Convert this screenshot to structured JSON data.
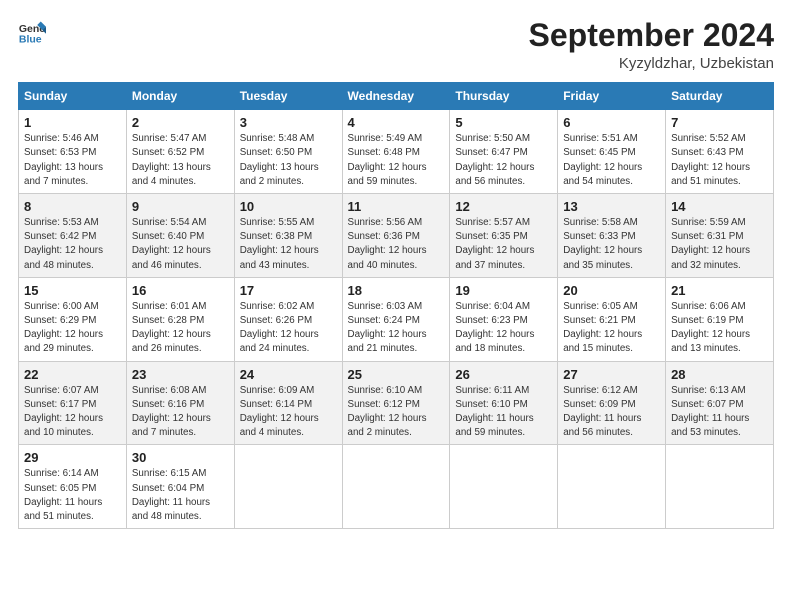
{
  "header": {
    "logo_general": "General",
    "logo_blue": "Blue",
    "title": "September 2024",
    "location": "Kyzyldzhar, Uzbekistan"
  },
  "weekdays": [
    "Sunday",
    "Monday",
    "Tuesday",
    "Wednesday",
    "Thursday",
    "Friday",
    "Saturday"
  ],
  "weeks": [
    [
      {
        "day": "1",
        "detail": "Sunrise: 5:46 AM\nSunset: 6:53 PM\nDaylight: 13 hours\nand 7 minutes."
      },
      {
        "day": "2",
        "detail": "Sunrise: 5:47 AM\nSunset: 6:52 PM\nDaylight: 13 hours\nand 4 minutes."
      },
      {
        "day": "3",
        "detail": "Sunrise: 5:48 AM\nSunset: 6:50 PM\nDaylight: 13 hours\nand 2 minutes."
      },
      {
        "day": "4",
        "detail": "Sunrise: 5:49 AM\nSunset: 6:48 PM\nDaylight: 12 hours\nand 59 minutes."
      },
      {
        "day": "5",
        "detail": "Sunrise: 5:50 AM\nSunset: 6:47 PM\nDaylight: 12 hours\nand 56 minutes."
      },
      {
        "day": "6",
        "detail": "Sunrise: 5:51 AM\nSunset: 6:45 PM\nDaylight: 12 hours\nand 54 minutes."
      },
      {
        "day": "7",
        "detail": "Sunrise: 5:52 AM\nSunset: 6:43 PM\nDaylight: 12 hours\nand 51 minutes."
      }
    ],
    [
      {
        "day": "8",
        "detail": "Sunrise: 5:53 AM\nSunset: 6:42 PM\nDaylight: 12 hours\nand 48 minutes."
      },
      {
        "day": "9",
        "detail": "Sunrise: 5:54 AM\nSunset: 6:40 PM\nDaylight: 12 hours\nand 46 minutes."
      },
      {
        "day": "10",
        "detail": "Sunrise: 5:55 AM\nSunset: 6:38 PM\nDaylight: 12 hours\nand 43 minutes."
      },
      {
        "day": "11",
        "detail": "Sunrise: 5:56 AM\nSunset: 6:36 PM\nDaylight: 12 hours\nand 40 minutes."
      },
      {
        "day": "12",
        "detail": "Sunrise: 5:57 AM\nSunset: 6:35 PM\nDaylight: 12 hours\nand 37 minutes."
      },
      {
        "day": "13",
        "detail": "Sunrise: 5:58 AM\nSunset: 6:33 PM\nDaylight: 12 hours\nand 35 minutes."
      },
      {
        "day": "14",
        "detail": "Sunrise: 5:59 AM\nSunset: 6:31 PM\nDaylight: 12 hours\nand 32 minutes."
      }
    ],
    [
      {
        "day": "15",
        "detail": "Sunrise: 6:00 AM\nSunset: 6:29 PM\nDaylight: 12 hours\nand 29 minutes."
      },
      {
        "day": "16",
        "detail": "Sunrise: 6:01 AM\nSunset: 6:28 PM\nDaylight: 12 hours\nand 26 minutes."
      },
      {
        "day": "17",
        "detail": "Sunrise: 6:02 AM\nSunset: 6:26 PM\nDaylight: 12 hours\nand 24 minutes."
      },
      {
        "day": "18",
        "detail": "Sunrise: 6:03 AM\nSunset: 6:24 PM\nDaylight: 12 hours\nand 21 minutes."
      },
      {
        "day": "19",
        "detail": "Sunrise: 6:04 AM\nSunset: 6:23 PM\nDaylight: 12 hours\nand 18 minutes."
      },
      {
        "day": "20",
        "detail": "Sunrise: 6:05 AM\nSunset: 6:21 PM\nDaylight: 12 hours\nand 15 minutes."
      },
      {
        "day": "21",
        "detail": "Sunrise: 6:06 AM\nSunset: 6:19 PM\nDaylight: 12 hours\nand 13 minutes."
      }
    ],
    [
      {
        "day": "22",
        "detail": "Sunrise: 6:07 AM\nSunset: 6:17 PM\nDaylight: 12 hours\nand 10 minutes."
      },
      {
        "day": "23",
        "detail": "Sunrise: 6:08 AM\nSunset: 6:16 PM\nDaylight: 12 hours\nand 7 minutes."
      },
      {
        "day": "24",
        "detail": "Sunrise: 6:09 AM\nSunset: 6:14 PM\nDaylight: 12 hours\nand 4 minutes."
      },
      {
        "day": "25",
        "detail": "Sunrise: 6:10 AM\nSunset: 6:12 PM\nDaylight: 12 hours\nand 2 minutes."
      },
      {
        "day": "26",
        "detail": "Sunrise: 6:11 AM\nSunset: 6:10 PM\nDaylight: 11 hours\nand 59 minutes."
      },
      {
        "day": "27",
        "detail": "Sunrise: 6:12 AM\nSunset: 6:09 PM\nDaylight: 11 hours\nand 56 minutes."
      },
      {
        "day": "28",
        "detail": "Sunrise: 6:13 AM\nSunset: 6:07 PM\nDaylight: 11 hours\nand 53 minutes."
      }
    ],
    [
      {
        "day": "29",
        "detail": "Sunrise: 6:14 AM\nSunset: 6:05 PM\nDaylight: 11 hours\nand 51 minutes."
      },
      {
        "day": "30",
        "detail": "Sunrise: 6:15 AM\nSunset: 6:04 PM\nDaylight: 11 hours\nand 48 minutes."
      },
      null,
      null,
      null,
      null,
      null
    ]
  ]
}
